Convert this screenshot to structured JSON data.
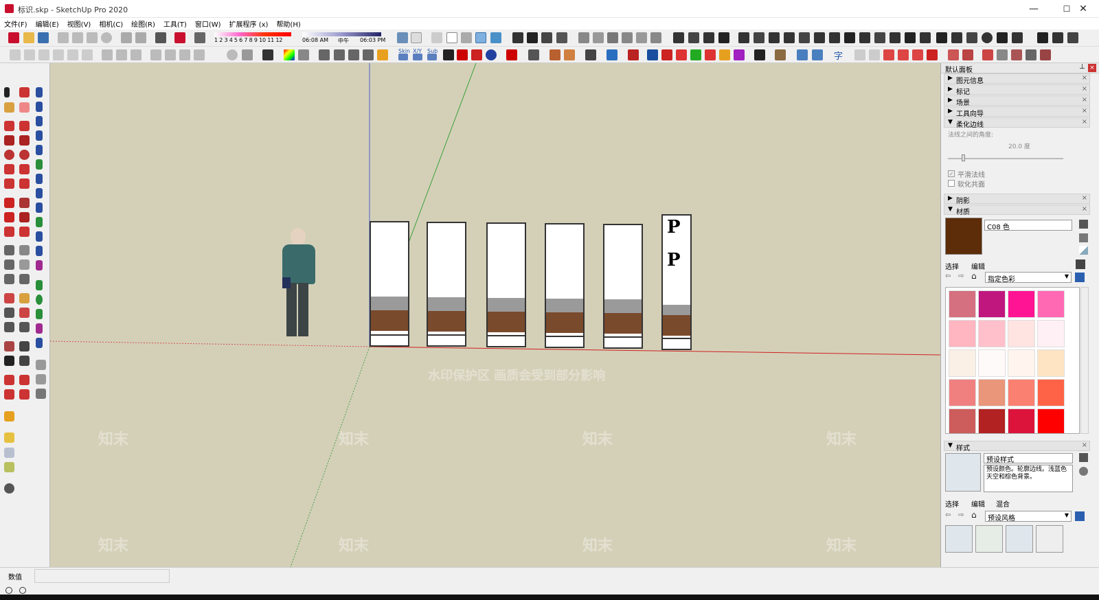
{
  "window": {
    "title": "标识.skp - SketchUp Pro 2020",
    "minimize": "—",
    "maximize": "☐",
    "close": "✕"
  },
  "menu": [
    "文件(F)",
    "编辑(E)",
    "视图(V)",
    "相机(C)",
    "绘图(R)",
    "工具(T)",
    "窗口(W)",
    "扩展程序 (x)",
    "帮助(H)"
  ],
  "toolbar": {
    "shadow_months": "1 2 3 4 5 6 7 8 9 10 11 12",
    "time_start": "06:08 AM",
    "time_mid": "中午",
    "time_end": "06:03 PM",
    "skin_label": "Skin",
    "xy_label": "X/Y",
    "sub_label": "Sub",
    "char_label": "字"
  },
  "viewport": {
    "watermark_banner": "水印保护区   画质会受到部分影响",
    "watermark_text": "知末",
    "sign_p_letter": "P"
  },
  "right_panel": {
    "tray_title": "默认面板",
    "sections": {
      "entity_info": "图元信息",
      "tags": "标记",
      "scenes": "场景",
      "instructor": "工具向导",
      "soften": "柔化边线",
      "shadows": "阴影",
      "materials": "材质",
      "styles": "样式"
    },
    "soften": {
      "angle_label": "法线之间的角度:",
      "angle_value": "20.0  度",
      "smooth_normals": "平滑法线",
      "soften_coplanar": "软化共面"
    },
    "materials": {
      "name": "C08 色",
      "tab_select": "选择",
      "tab_edit": "编辑",
      "library": "指定色彩",
      "current_color": "#5c2d08",
      "swatches": [
        "#d4707f",
        "#c0177f",
        "#ff1493",
        "#ff69b4",
        "#ffb6c1",
        "#ffc0cb",
        "#ffe4e1",
        "#fff0f5",
        "#faf0e6",
        "#fffafa",
        "#fff5ee",
        "#ffe4c4",
        "#f08080",
        "#e9967a",
        "#fa8072",
        "#ff6347",
        "#cd5c5c",
        "#b22222",
        "#dc143c",
        "#ff0000"
      ]
    },
    "styles": {
      "name": "预设样式",
      "description": "预设颜色。轮廓边线。浅蓝色天空和棕色背景。",
      "tab_select": "选择",
      "tab_edit": "编辑",
      "tab_mix": "混合",
      "library": "预设风格"
    }
  },
  "status": {
    "measurements_label": "数值"
  }
}
